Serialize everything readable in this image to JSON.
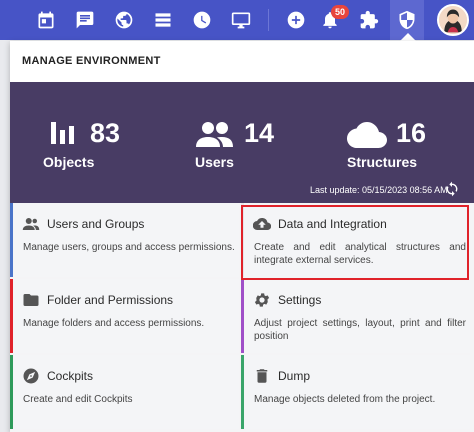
{
  "topbar": {
    "icons": [
      "calendar-icon",
      "chat-icon",
      "globe-icon",
      "list-icon",
      "clock-icon",
      "monitor-icon",
      "add-icon",
      "bell-icon",
      "puzzle-icon",
      "shield-icon",
      "avatar"
    ],
    "notification_count": "50"
  },
  "panel": {
    "title": "MANAGE ENVIRONMENT",
    "stats": [
      {
        "icon": "bar-chart-icon",
        "value": "83",
        "label": "Objects"
      },
      {
        "icon": "users-icon",
        "value": "14",
        "label": "Users"
      },
      {
        "icon": "cloud-icon",
        "value": "16",
        "label": "Structures"
      }
    ],
    "last_update": "Last update: 05/15/2023 08:56 AM"
  },
  "tiles": [
    {
      "title": "Users and Groups",
      "desc": "Manage users, groups and access permissions.",
      "icon": "users-icon",
      "accent": "#4a74c9"
    },
    {
      "title": "Data and Integration",
      "desc": "Create and edit analytical structures and integrate external services.",
      "icon": "cloud-upload-icon",
      "accent": "#e0e0e0"
    },
    {
      "title": "Folder and Permissions",
      "desc": "Manage folders and access permissions.",
      "icon": "folder-icon",
      "accent": "#e0222a"
    },
    {
      "title": "Settings",
      "desc": "Adjust project settings, layout, print and filter position",
      "icon": "gear-icon",
      "accent": "#a04fc8"
    },
    {
      "title": "Cockpits",
      "desc": "Create and edit Cockpits",
      "icon": "compass-icon",
      "accent": "#2e9a5a"
    },
    {
      "title": "Dump",
      "desc": "Manage objects deleted from the project.",
      "icon": "trash-icon",
      "accent": "#3aa56a"
    }
  ],
  "colors": {
    "topbar": "#4754c6",
    "stats_bg": "#483c64",
    "highlight": "#e0222a"
  }
}
